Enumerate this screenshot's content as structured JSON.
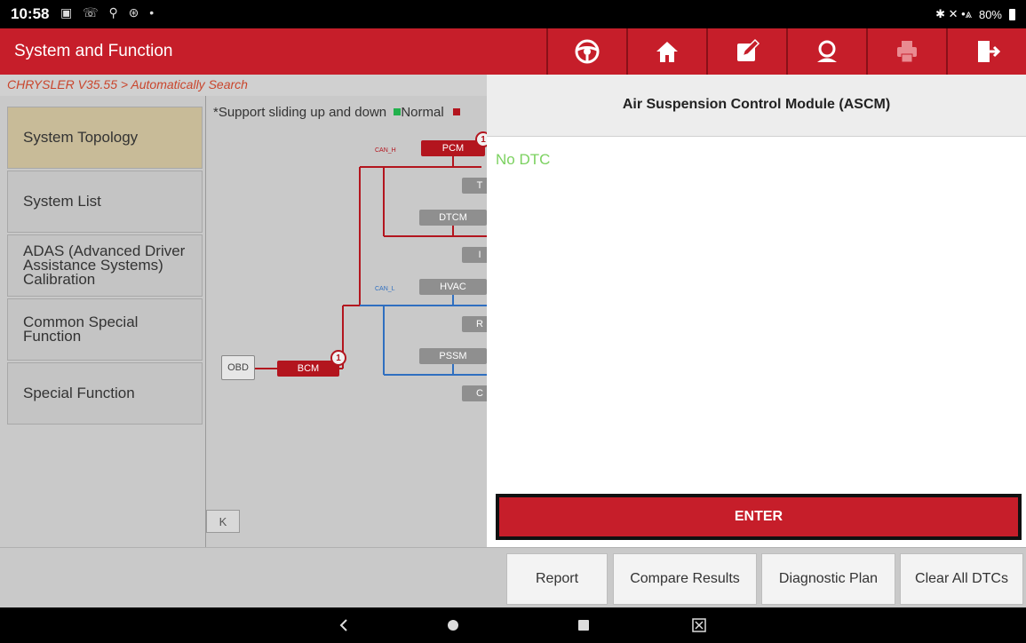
{
  "status_bar": {
    "time": "10:58",
    "left_icons": "▣ ☏ ⚲ ⊛ •",
    "right_icons": "✱ ✕ •⩓",
    "battery": "80%"
  },
  "title_bar": {
    "title": "System and Function",
    "toolbar": [
      {
        "icon": "steering-wheel-icon"
      },
      {
        "icon": "home-icon"
      },
      {
        "icon": "edit-note-icon"
      },
      {
        "icon": "support-agent-icon"
      },
      {
        "icon": "print-icon"
      },
      {
        "icon": "exit-icon"
      }
    ]
  },
  "breadcrumb": "CHRYSLER V35.55 > Automatically Search",
  "sidebar": {
    "items": [
      {
        "label": "System Topology",
        "active": true
      },
      {
        "label": "System List",
        "active": false
      },
      {
        "label": "ADAS (Advanced Driver\nAssistance Systems)\nCalibration",
        "active": false
      },
      {
        "label": "Common Special\nFunction",
        "active": false
      },
      {
        "label": "Special Function",
        "active": false
      }
    ]
  },
  "topology": {
    "note": "*Support sliding up and down",
    "legend_normal": "Normal",
    "legend_normal_color": "#22b14c",
    "legend_fault_color": "#b3151e",
    "bus_high": "CAN_H",
    "bus_low": "CAN_L",
    "nodes": {
      "pcm": "PCM",
      "dtcm": "DTCM",
      "hvac": "HVAC",
      "pssm": "PSSM",
      "bcm": "BCM",
      "obd": "OBD",
      "cut1": "T",
      "cut2": "I",
      "cut3": "R",
      "cut4": "C"
    },
    "badges": {
      "pcm": "1",
      "bcm": "1"
    },
    "collapse_label": "K"
  },
  "panel": {
    "title": "Air Suspension Control Module (ASCM)",
    "dtc_text": "No DTC",
    "enter_label": "ENTER"
  },
  "bottom_buttons": [
    "Report",
    "Compare Results",
    "Diagnostic Plan",
    "Clear All DTCs"
  ],
  "nav": {
    "back": "back-icon",
    "home": "home-circle-icon",
    "recents": "recents-icon",
    "screenshot": "screenshot-icon"
  },
  "colors": {
    "brand_red": "#c61e2a",
    "active_item": "#c8bb98",
    "ok_green": "#7bd15f",
    "can_high": "#b3151e",
    "can_low": "#2f6fc0"
  }
}
